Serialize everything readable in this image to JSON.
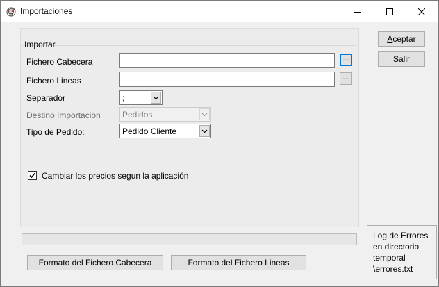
{
  "window": {
    "title": "Importaciones",
    "minimize_label": "—",
    "maximize_label": "☐",
    "close_label": "✕"
  },
  "group": {
    "legend": "Importar"
  },
  "form": {
    "fichero_cabecera_label": "Fichero Cabecera",
    "fichero_cabecera_value": "",
    "fichero_lineas_label": "Fichero Lineas",
    "fichero_lineas_value": "",
    "browse_label": "...",
    "separador_label": "Separador",
    "separador_value": ";",
    "destino_label": "Destino Importación",
    "destino_value": "Pedidos",
    "tipo_label": "Tipo de Pedido:",
    "tipo_value": "Pedido Cliente",
    "cambiar_precios_label": "Cambiar los precios segun la aplicación",
    "cambiar_precios_checked": true
  },
  "buttons": {
    "aceptar_first": "A",
    "aceptar_rest": "ceptar",
    "salir_first": "S",
    "salir_rest": "alir",
    "formato_cabecera": "Formato del Fichero Cabecera",
    "formato_lineas": "Formato del Fichero Lineas"
  },
  "log": {
    "lines": [
      "Log de Errores",
      "en directorio",
      "temporal",
      "\\errores.txt"
    ]
  },
  "progress": {
    "fraction": 0
  }
}
